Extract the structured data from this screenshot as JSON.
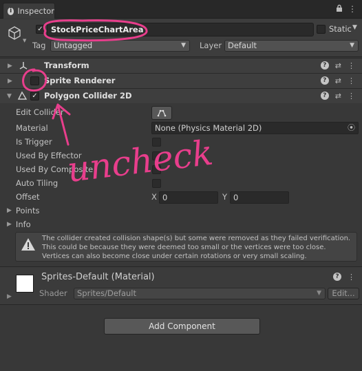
{
  "tab": {
    "title": "Inspector"
  },
  "header": {
    "object_name": "StockPriceChartArea",
    "static_label": "Static",
    "tag_label": "Tag",
    "tag_value": "Untagged",
    "layer_label": "Layer",
    "layer_value": "Default"
  },
  "components": {
    "transform": {
      "title": "Transform"
    },
    "sprite_renderer": {
      "title": "Sprite Renderer",
      "enabled": false
    },
    "polygon_collider": {
      "title": "Polygon Collider 2D",
      "enabled": true
    }
  },
  "props": {
    "edit_collider": "Edit Collider",
    "material": "Material",
    "material_value": "None (Physics Material 2D)",
    "is_trigger": "Is Trigger",
    "used_by_effector": "Used By Effector",
    "used_by_composite": "Used By Composite",
    "auto_tiling": "Auto Tiling",
    "offset": "Offset",
    "offset_x_label": "X",
    "offset_x": "0",
    "offset_y_label": "Y",
    "offset_y": "0",
    "points": "Points",
    "info": "Info"
  },
  "warning": {
    "text": "The collider created collision shape(s) but some were removed as they failed verification. This could be because they were deemed too small or the vertices were too close.  Vertices can also become close under certain rotations or very small scaling."
  },
  "material": {
    "title": "Sprites-Default (Material)",
    "shader_label": "Shader",
    "shader_value": "Sprites/Default",
    "edit_label": "Edit..."
  },
  "add_component_label": "Add Component",
  "annotation": {
    "text": "uncheck",
    "color": "#e83e8c"
  },
  "icons": {
    "tab": "info-icon",
    "object": "cube-icon",
    "transform": "transform-axes-icon",
    "collider": "polygon-collider-icon",
    "help": "help-icon",
    "presets": "sliders-icon",
    "menu": "kebab-menu-icon",
    "lock": "lock-icon"
  }
}
